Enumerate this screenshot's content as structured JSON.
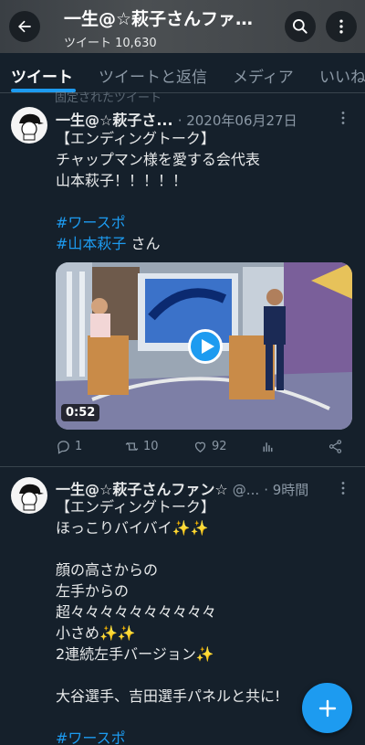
{
  "header": {
    "title": "一生@☆萩子さんファ…",
    "tweet_count": "ツイート 10,630"
  },
  "tabs": [
    {
      "label": "ツイート",
      "active": true
    },
    {
      "label": "ツイートと返信",
      "active": false
    },
    {
      "label": "メディア",
      "active": false
    },
    {
      "label": "いいね",
      "active": false
    }
  ],
  "partial_line": "固定されたツイート",
  "tweets": [
    {
      "name": "一生@☆萩子さ...",
      "date": "· 2020年06月27日",
      "lines": [
        {
          "text": "【エンディングトーク】"
        },
        {
          "text": "チャップマン様を愛する会代表"
        },
        {
          "text": "山本萩子！！！！！"
        },
        {
          "text": ""
        },
        {
          "text": "#ワースポ",
          "link": true
        }
      ],
      "mention_line": {
        "tag": "#山本萩子",
        "suffix": " さん"
      },
      "video_duration": "0:52",
      "stats": {
        "replies": "1",
        "retweets": "10",
        "likes": "92"
      }
    },
    {
      "name": "一生@☆萩子さんファン☆",
      "handle": "@...",
      "date": "· 9時間",
      "lines": [
        {
          "text": "【エンディングトーク】"
        },
        {
          "text": "ほっこりバイバイ✨✨"
        },
        {
          "text": ""
        },
        {
          "text": "顔の高さからの"
        },
        {
          "text": "左手からの"
        },
        {
          "text": "超々々々々々々々々々々"
        },
        {
          "text": "小さめ✨✨"
        },
        {
          "text": "2連続左手バージョン✨"
        },
        {
          "text": ""
        },
        {
          "text": "大谷選手、吉田選手パネルと共に!"
        },
        {
          "text": ""
        },
        {
          "text": "#ワースポ",
          "link": true
        }
      ]
    }
  ],
  "colors": {
    "accent": "#1d9bf0",
    "background": "#15202b",
    "muted": "#8b98a5"
  },
  "icons": [
    "back-arrow-icon",
    "search-icon",
    "more-vertical-icon",
    "reply-icon",
    "retweet-icon",
    "like-icon",
    "analytics-icon",
    "share-icon",
    "compose-plus-icon",
    "play-icon"
  ]
}
